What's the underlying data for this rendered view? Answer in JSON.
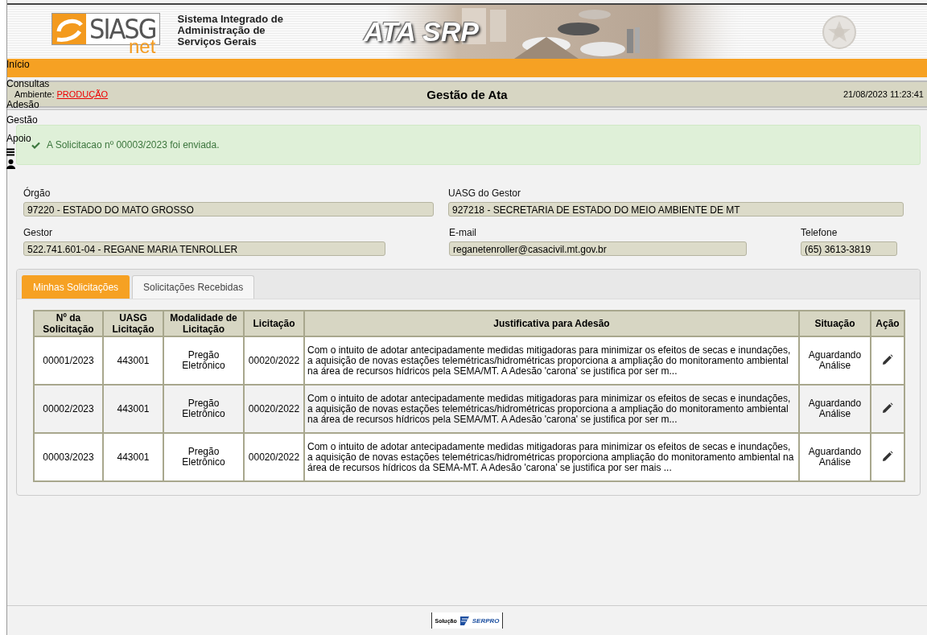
{
  "header": {
    "logo_text": "SIASG",
    "logo_subtext": "net",
    "system_name": [
      "Sistema Integrado de",
      "Administração de",
      "Serviços Gerais"
    ],
    "banner_title": "ATA SRP"
  },
  "menu": [
    {
      "label": "Início"
    },
    {
      "label": "Consultas"
    },
    {
      "label": "Adesão"
    },
    {
      "label": "Gestão"
    },
    {
      "label": "Apoio"
    }
  ],
  "title_bar": {
    "environment_label": "Ambiente:",
    "environment_value": "PRODUÇÃO",
    "title": "Gestão de Ata",
    "datetime": "21/08/2023 11:23:41"
  },
  "alert": {
    "kind": "success",
    "message": "A Solicitacao nº 00003/2023 foi enviada."
  },
  "field_rows": [
    [
      {
        "label": "Órgão",
        "value": "97220 - ESTADO DO MATO GROSSO"
      },
      {
        "label": "UASG do Gestor",
        "value": "927218 - SECRETARIA DE ESTADO DO MEIO AMBIENTE DE MT"
      }
    ],
    [
      {
        "label": "Gestor",
        "value": "522.741.601-04 - REGANE MARIA TENROLLER"
      },
      {
        "label": "E-mail",
        "value": "reganetenroller@casacivil.mt.gov.br"
      },
      {
        "label": "Telefone",
        "value": "(65) 3613-3819"
      }
    ]
  ],
  "tabs": [
    {
      "label": "Minhas Solicitações",
      "selected": true
    },
    {
      "label": "Solicitações Recebidas",
      "selected": false
    }
  ],
  "table": {
    "columns": [
      "Nº da Solicitação",
      "UASG Licitação",
      "Modalidade de Licitação",
      "Licitação",
      "Justificativa para Adesão",
      "Situação",
      "Ação"
    ],
    "rows": [
      {
        "cells": [
          "00001/2023",
          "443001",
          "Pregão Eletrônico",
          "00020/2022",
          "Com o intuito de adotar antecipadamente medidas mitigadoras para minimizar os efeitos de secas e inundações, a aquisição de novas estações telemétricas/hidrométricas proporciona a ampliação do monitoramento ambiental na área de recursos hídricos pela SEMA/MT. A Adesão 'carona' se justifica por ser m...",
          "Aguardando Análise"
        ]
      },
      {
        "cells": [
          "00002/2023",
          "443001",
          "Pregão Eletrônico",
          "00020/2022",
          "Com o intuito de adotar antecipadamente medidas mitigadoras para minimizar os efeitos de secas e inundações, a aquisição de novas estações telemétricas/hidrométricas proporciona a ampliação do monitoramento ambiental na área de recursos hídricos pela SEMA/MT. A Adesão 'carona' se justifica por ser m...",
          "Aguardando Análise"
        ]
      },
      {
        "cells": [
          "00003/2023",
          "443001",
          "Pregão Eletrônico",
          "00020/2022",
          "Com o intuito de adotar antecipadamente medidas mitigadoras para minimizar os efeitos de secas e inundações, a aquisição de novas estações telemétricas/hidrométricas proporciona ampliação do monitoramento ambiental na área de recursos hídricos da SEMA-MT. A Adesão 'carona' se justifica por ser mais ...",
          "Aguardando Análise"
        ]
      }
    ]
  },
  "footer": {
    "prefix": "Solução",
    "brand": "SERPRO"
  }
}
